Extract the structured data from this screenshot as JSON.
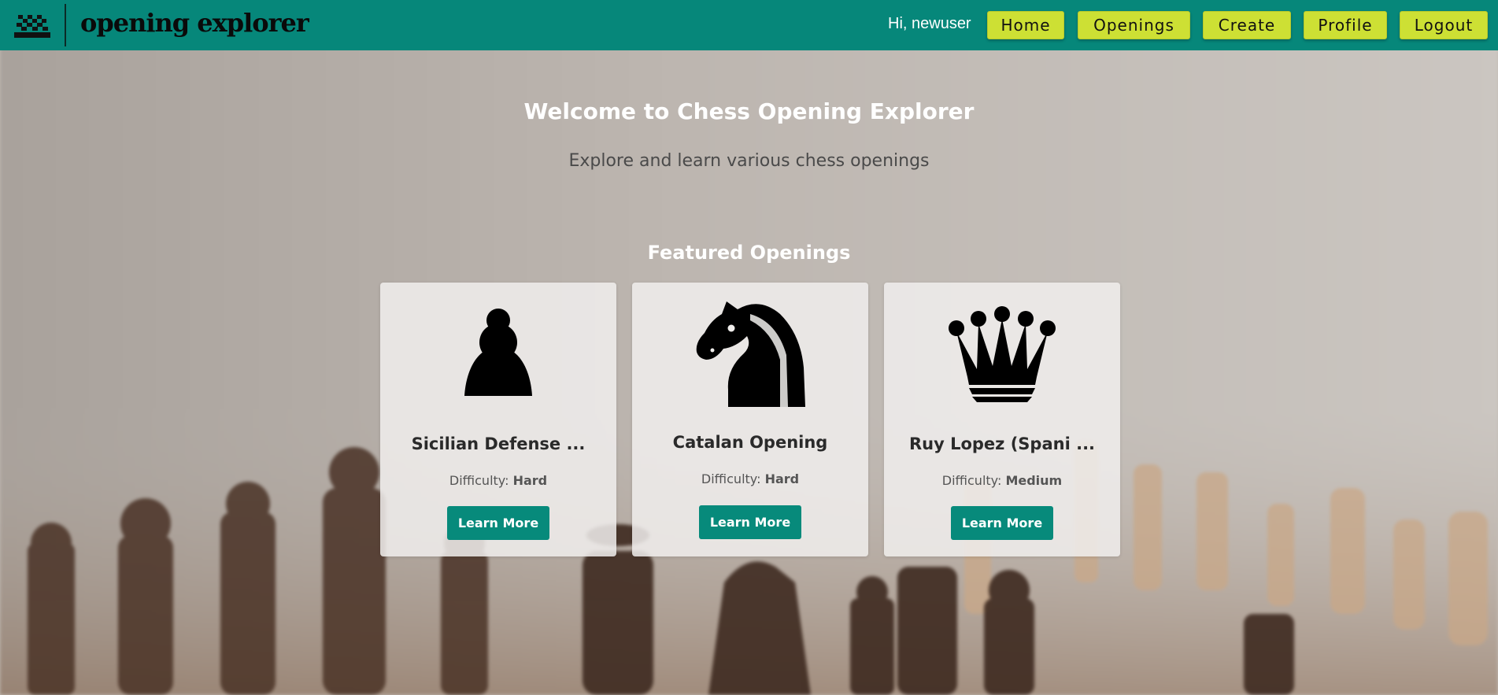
{
  "nav": {
    "logo_text": "opening explorer",
    "greeting": "Hi, newuser",
    "buttons": [
      "Home",
      "Openings",
      "Create",
      "Profile",
      "Logout"
    ]
  },
  "hero": {
    "title": "Welcome to Chess Opening Explorer",
    "subtitle": "Explore and learn various chess openings"
  },
  "featured": {
    "title": "Featured Openings",
    "difficulty_label": "Difficulty:",
    "cards": [
      {
        "piece_icon": "pawn-icon",
        "name": "Sicilian Defense ...",
        "difficulty": "Hard",
        "button": "Learn More"
      },
      {
        "piece_icon": "knight-icon",
        "name": "Catalan Opening",
        "difficulty": "Hard",
        "button": "Learn More"
      },
      {
        "piece_icon": "queen-icon",
        "name": "Ruy Lopez (Spani ...",
        "difficulty": "Medium",
        "button": "Learn More"
      }
    ]
  },
  "colors": {
    "nav_bg": "#06877a",
    "nav_button_bg": "#cde034",
    "card_button_bg": "#078a7b"
  }
}
